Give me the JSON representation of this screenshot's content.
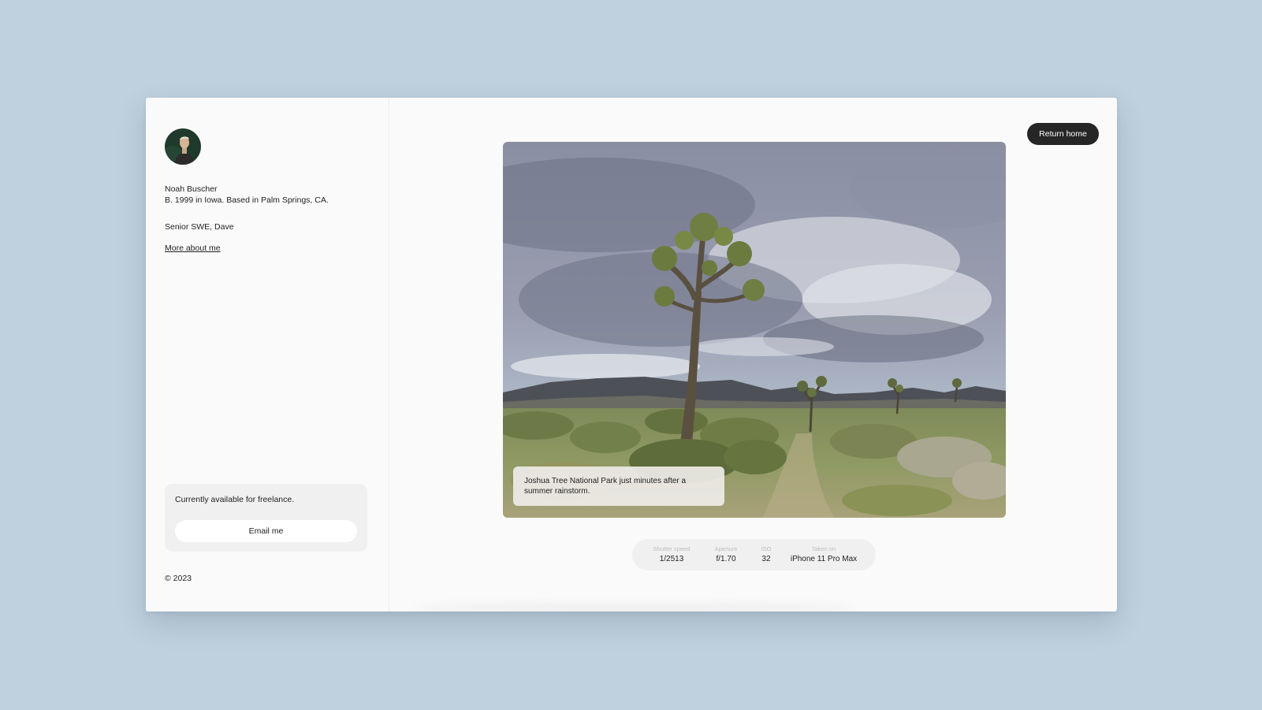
{
  "profile": {
    "name": "Noah Buscher",
    "bio": "B. 1999 in Iowa. Based in Palm Springs, CA.",
    "role": "Senior SWE, Dave",
    "about_link": "More about me"
  },
  "freelance": {
    "text": "Currently available for freelance.",
    "email_label": "Email me"
  },
  "footer": {
    "copyright": "© 2023"
  },
  "nav": {
    "return_label": "Return home"
  },
  "photo": {
    "caption": "Joshua Tree National Park just minutes after a summer rainstorm."
  },
  "exif": [
    {
      "label": "Shutter speed",
      "value": "1/2513"
    },
    {
      "label": "Aperture",
      "value": "f/1.70"
    },
    {
      "label": "ISO",
      "value": "32"
    },
    {
      "label": "Taken on",
      "value": "iPhone 11 Pro Max"
    }
  ],
  "colors": {
    "background": "#bfd0de",
    "panel": "#fafafa",
    "button_dark": "#262626",
    "card": "#f0f0f0"
  }
}
